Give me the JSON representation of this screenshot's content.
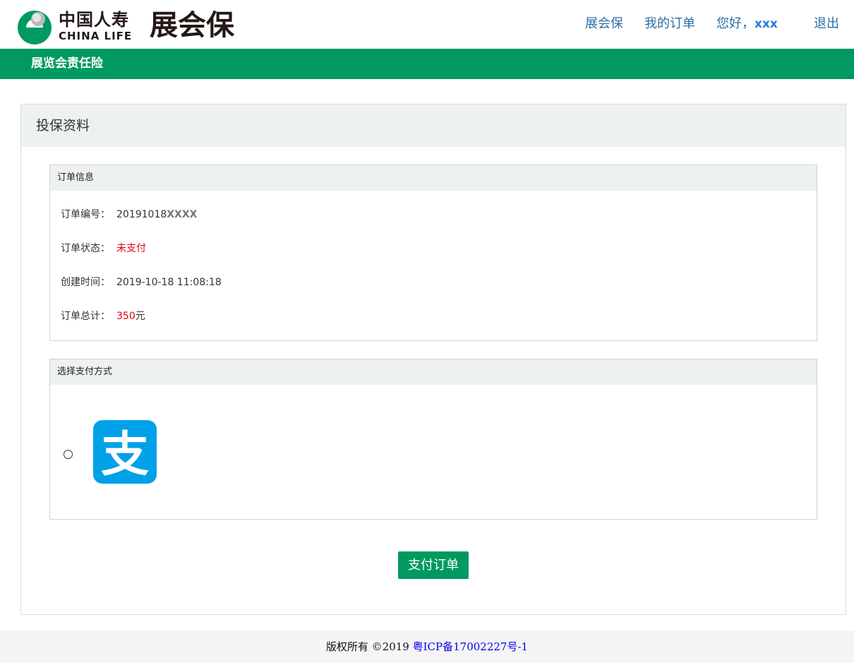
{
  "header": {
    "brand_cn": "中国人寿",
    "brand_en": "CHINA LIFE",
    "product_name": "展会保",
    "nav": {
      "home": "展会保",
      "my_orders": "我的订单",
      "greeting": "您好，",
      "user_name": "xxx",
      "logout": "退出"
    }
  },
  "subheader": {
    "title": "展览会责任险"
  },
  "panel": {
    "title": "投保资料",
    "order_info": {
      "title": "订单信息",
      "order_no_label": "订单编号：",
      "order_no_value": "20191018",
      "order_no_mask": "XXXX",
      "status_label": "订单状态：",
      "status_value": "未支付",
      "created_label": "创建时间：",
      "created_value": "2019-10-18 11:08:18",
      "total_label": "订单总计：",
      "total_amount": "350",
      "total_unit": "元"
    },
    "payment": {
      "title": "选择支付方式",
      "method_icon": "alipay-icon",
      "selected": false
    },
    "pay_button": "支付订单"
  },
  "footer": {
    "copyright": "版权所有 ©2019 ",
    "icp": "粤ICP备17002227号-1"
  },
  "colors": {
    "brand_green": "#009a61",
    "link_blue": "#2e6da4",
    "alert_red": "#e60012",
    "alipay_blue": "#00a1e9"
  }
}
